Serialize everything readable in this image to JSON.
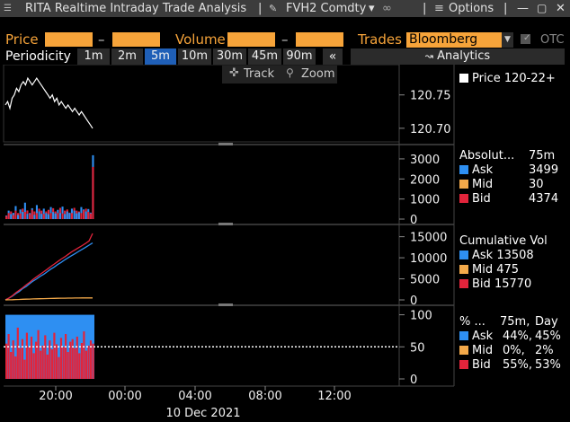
{
  "window": {
    "title": "RITA Realtime Intraday Trade Analysis",
    "security": "FVH2 Comdty",
    "options_label": "Options"
  },
  "filters": {
    "price_label": "Price",
    "volume_label": "Volume",
    "dash": "–",
    "trades_label": "Trades",
    "trades_source": "Bloomberg",
    "otc_label": "OTC"
  },
  "periodicity": {
    "label": "Periodicity",
    "options": [
      "1m",
      "2m",
      "5m",
      "10m",
      "30m",
      "45m",
      "90m"
    ],
    "selected": "5m",
    "collapse_label": "«",
    "analytics_label": "Analytics"
  },
  "tools": {
    "track_label": "Track",
    "zoom_label": "Zoom"
  },
  "colors": {
    "ask": "#2e8ff2",
    "mid": "#f3a94a",
    "bid": "#e2243b",
    "accent_orange": "#f7a43a",
    "price_line": "#ffffff"
  },
  "legends": {
    "price": {
      "label": "Price",
      "value": "120-22+"
    },
    "absolute": {
      "header_left": "Absolut...",
      "header_right": "75m",
      "rows": [
        {
          "name": "Ask",
          "value": "3499"
        },
        {
          "name": "Mid",
          "value": "30"
        },
        {
          "name": "Bid",
          "value": "4374"
        }
      ]
    },
    "cumulative": {
      "header": "Cumulative Vol",
      "rows": [
        {
          "name": "Ask",
          "value": "13508"
        },
        {
          "name": "Mid",
          "value": "475"
        },
        {
          "name": "Bid",
          "value": "15770"
        }
      ]
    },
    "percent": {
      "header_left": "% ...",
      "header_mid": "75m,",
      "header_right": "Day",
      "rows": [
        {
          "name": "Ask",
          "v1": "44%,",
          "v2": "45%"
        },
        {
          "name": "Mid",
          "v1": "0%,",
          "v2": "2%"
        },
        {
          "name": "Bid",
          "v1": "55%,",
          "v2": "53%"
        }
      ]
    }
  },
  "chart_data": [
    {
      "type": "line",
      "panel": "price",
      "y_ticks": [
        "120.75",
        "120.70"
      ],
      "ylim": [
        120.685,
        120.79
      ],
      "x": [
        0,
        1,
        2,
        3,
        4,
        5,
        6,
        7,
        8,
        9,
        10,
        11,
        12,
        13,
        14,
        15,
        16,
        17,
        18,
        19,
        20,
        21,
        22,
        23,
        24,
        25,
        26,
        27,
        28,
        29,
        30,
        31,
        32,
        33,
        34,
        35,
        36,
        37,
        38,
        39
      ],
      "values": [
        120.735,
        120.74,
        120.73,
        120.745,
        120.75,
        120.76,
        120.755,
        120.765,
        120.77,
        120.765,
        120.775,
        120.77,
        120.765,
        120.77,
        120.775,
        120.77,
        120.765,
        120.76,
        120.755,
        120.75,
        120.745,
        120.75,
        120.74,
        120.745,
        120.735,
        120.74,
        120.735,
        120.73,
        120.735,
        120.73,
        120.725,
        120.73,
        120.725,
        120.72,
        120.725,
        120.72,
        120.715,
        120.71,
        120.705,
        120.7
      ]
    },
    {
      "type": "bar",
      "panel": "absolute",
      "y_ticks": [
        "3000",
        "2000",
        "1000",
        "0"
      ],
      "ylim": [
        0,
        3400
      ],
      "series": [
        {
          "name": "Ask",
          "values": [
            180,
            420,
            250,
            310,
            650,
            200,
            480,
            360,
            820,
            260,
            300,
            540,
            210,
            700,
            380,
            260,
            520,
            300,
            240,
            600,
            350,
            280,
            460,
            300,
            620,
            250,
            380,
            300,
            520,
            420,
            280,
            340,
            600,
            480,
            380,
            500,
            320,
            3180
          ]
        },
        {
          "name": "Bid",
          "values": [
            150,
            300,
            380,
            200,
            420,
            300,
            280,
            520,
            360,
            430,
            250,
            460,
            380,
            300,
            520,
            420,
            260,
            380,
            460,
            300,
            540,
            380,
            300,
            560,
            280,
            420,
            480,
            320,
            300,
            560,
            420,
            380,
            300,
            440,
            520,
            360,
            280,
            2600
          ]
        }
      ]
    },
    {
      "type": "line",
      "panel": "cumulative",
      "y_ticks": [
        "15000",
        "10000",
        "5000",
        "0"
      ],
      "ylim": [
        0,
        16200
      ],
      "series": [
        {
          "name": "Ask",
          "values": [
            0,
            400,
            900,
            1500,
            2000,
            2700,
            3200,
            3900,
            4500,
            5000,
            5600,
            6100,
            6700,
            7300,
            7800,
            8400,
            8900,
            9500,
            10000,
            10500,
            11000,
            11500,
            12000,
            12500,
            13000,
            13508
          ]
        },
        {
          "name": "Bid",
          "values": [
            0,
            450,
            1000,
            1700,
            2300,
            2900,
            3600,
            4200,
            4900,
            5500,
            6100,
            6700,
            7300,
            7900,
            8500,
            9100,
            9700,
            10200,
            10800,
            11400,
            11900,
            12400,
            12900,
            13400,
            14000,
            15770
          ]
        },
        {
          "name": "Mid",
          "values": [
            0,
            20,
            50,
            80,
            110,
            140,
            170,
            200,
            230,
            260,
            280,
            300,
            320,
            340,
            360,
            380,
            400,
            410,
            420,
            430,
            440,
            450,
            460,
            465,
            470,
            475
          ]
        }
      ]
    },
    {
      "type": "bar",
      "panel": "percent",
      "y_ticks": [
        "100",
        "50",
        "0"
      ],
      "ylim": [
        0,
        105
      ],
      "values_bid_pct": [
        55,
        70,
        42,
        60,
        35,
        80,
        48,
        62,
        30,
        72,
        50,
        66,
        40,
        58,
        76,
        44,
        52,
        68,
        38,
        60,
        46,
        72,
        54,
        34,
        64,
        50,
        70,
        42,
        58,
        62,
        48,
        66,
        40,
        56,
        74,
        44,
        52,
        60,
        55
      ]
    }
  ],
  "x_axis": {
    "ticks": [
      "20:00",
      "00:00",
      "04:00",
      "08:00",
      "12:00"
    ],
    "date": "10 Dec 2021"
  }
}
